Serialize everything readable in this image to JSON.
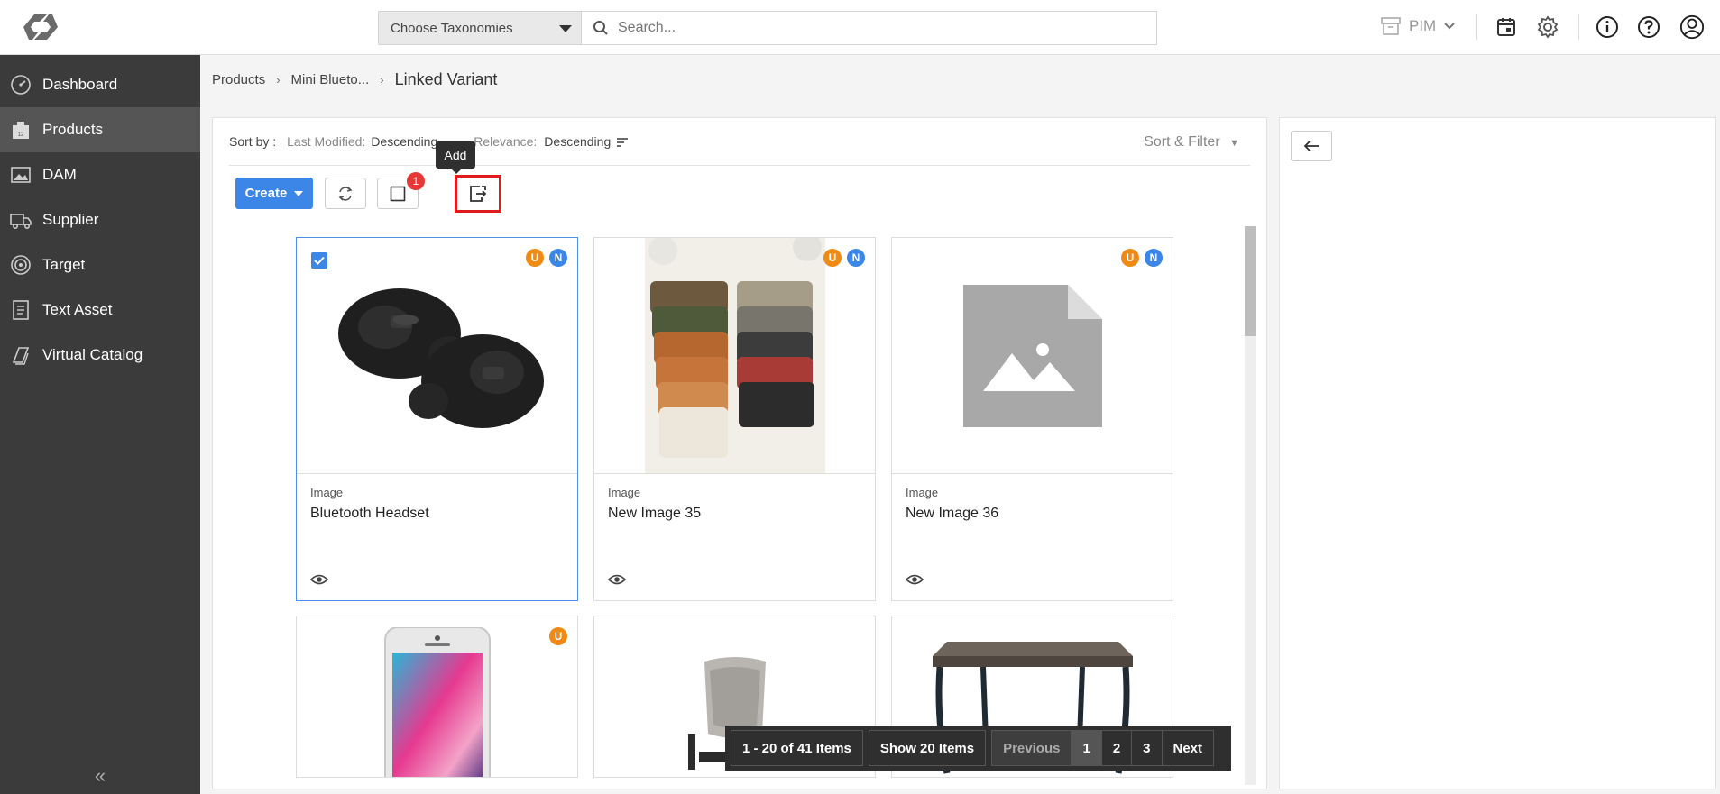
{
  "header": {
    "taxonomy_placeholder": "Choose Taxonomies",
    "search_placeholder": "Search...",
    "app_switcher": "PIM"
  },
  "sidebar": {
    "items": [
      {
        "label": "Dashboard",
        "icon": "dashboard-icon"
      },
      {
        "label": "Products",
        "icon": "products-icon",
        "active": true
      },
      {
        "label": "DAM",
        "icon": "image-icon"
      },
      {
        "label": "Supplier",
        "icon": "truck-icon"
      },
      {
        "label": "Target",
        "icon": "target-icon"
      },
      {
        "label": "Text Asset",
        "icon": "document-icon"
      },
      {
        "label": "Virtual Catalog",
        "icon": "book-icon"
      }
    ],
    "collapse_glyph": "«"
  },
  "breadcrumb": {
    "items": [
      "Products",
      "Mini Blueto..."
    ],
    "current": "Linked Variant"
  },
  "sortbar": {
    "label": "Sort by :",
    "last_modified_label": "Last Modified:",
    "last_modified_value": "Descending",
    "relevance_label": "Relevance:",
    "relevance_value": "Descending",
    "sort_filter": "Sort & Filter"
  },
  "toolbar": {
    "create_label": "Create",
    "selected_count": "1",
    "add_tooltip": "Add"
  },
  "cards": [
    {
      "type": "Image",
      "name": "Bluetooth Headset",
      "badges": [
        "U",
        "N"
      ],
      "selected": true
    },
    {
      "type": "Image",
      "name": "New Image 35",
      "badges": [
        "U",
        "N"
      ]
    },
    {
      "type": "Image",
      "name": "New Image 36",
      "badges": [
        "U",
        "N"
      ]
    },
    {
      "type": "",
      "name": "",
      "badges": [
        "U"
      ]
    },
    {
      "type": "",
      "name": "",
      "badges": []
    },
    {
      "type": "",
      "name": "",
      "badges": []
    }
  ],
  "pagination": {
    "summary": "1 - 20 of 41 Items",
    "page_size": "Show 20 Items",
    "previous": "Previous",
    "pages": [
      "1",
      "2",
      "3"
    ],
    "current_page": "1",
    "next": "Next"
  },
  "colors": {
    "accent": "#3c86e8",
    "sidebar_bg": "#3b3b3b",
    "badge_u": "#ef8a14",
    "badge_n": "#3c86e8",
    "highlight": "#e01b1b"
  }
}
